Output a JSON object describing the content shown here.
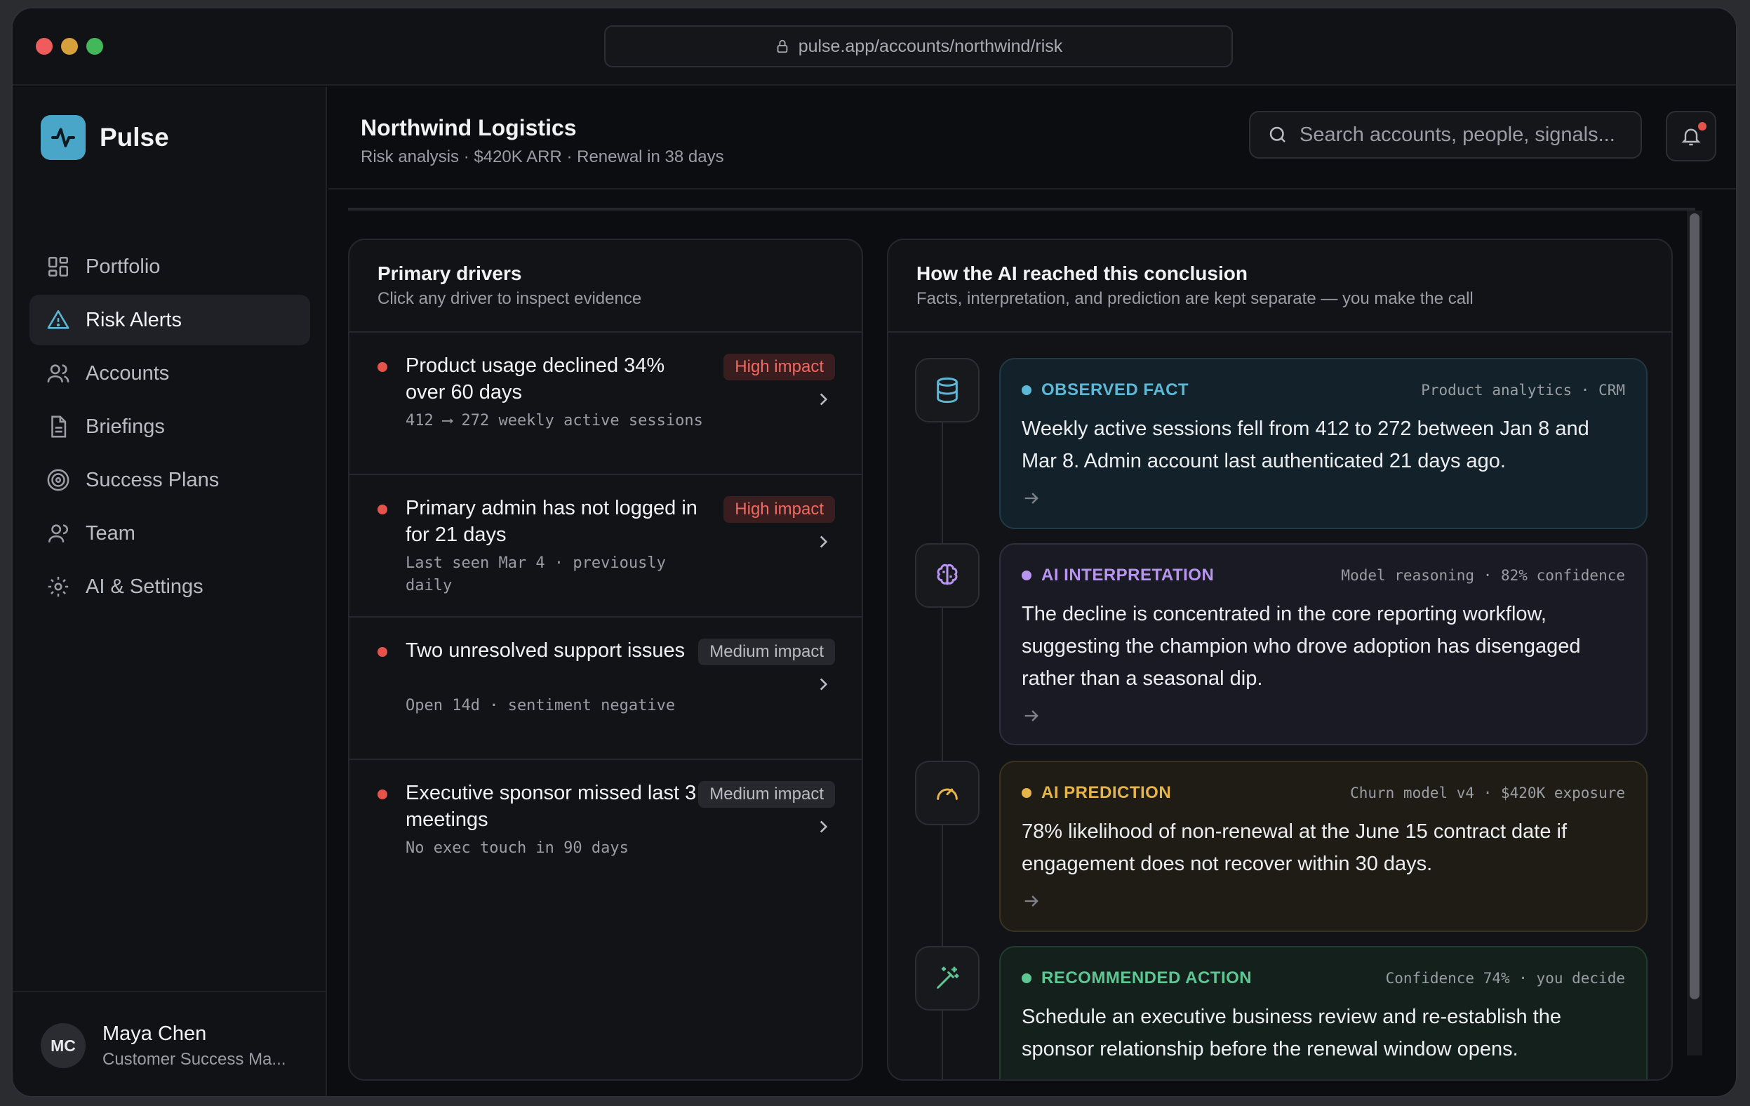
{
  "browser": {
    "url": "pulse.app/accounts/northwind/risk"
  },
  "brand": {
    "name": "Pulse"
  },
  "sidebar": {
    "items": [
      {
        "label": "Portfolio",
        "icon": "grid-icon"
      },
      {
        "label": "Risk Alerts",
        "icon": "alert-triangle-icon",
        "active": true
      },
      {
        "label": "Accounts",
        "icon": "users-icon"
      },
      {
        "label": "Briefings",
        "icon": "document-icon"
      },
      {
        "label": "Success Plans",
        "icon": "target-icon"
      },
      {
        "label": "Team",
        "icon": "user-icon"
      },
      {
        "label": "AI & Settings",
        "icon": "gear-icon"
      }
    ]
  },
  "user": {
    "initials": "MC",
    "name": "Maya Chen",
    "role": "Customer Success Ma..."
  },
  "header": {
    "title": "Northwind Logistics",
    "subtitle": "Risk analysis · $420K ARR · Renewal in 38 days",
    "search_placeholder": "Search accounts, people, signals..."
  },
  "drivers_panel": {
    "title": "Primary drivers",
    "subtitle": "Click any driver to inspect evidence",
    "drivers": [
      {
        "title": "Product usage declined 34% over 60 days",
        "meta": "412 ⟶ 272 weekly active sessions",
        "impact": "High impact",
        "level": "high"
      },
      {
        "title": "Primary admin has not logged in for 21 days",
        "meta": "Last seen Mar 4 · previously daily",
        "impact": "High impact",
        "level": "high"
      },
      {
        "title": "Two unresolved support issues",
        "meta": "Open 14d · sentiment negative",
        "impact": "Medium impact",
        "level": "medium"
      },
      {
        "title": "Executive sponsor missed last 3 meetings",
        "meta": "No exec touch in 90 days",
        "impact": "Medium impact",
        "level": "medium"
      }
    ]
  },
  "reasoning_panel": {
    "title": "How the AI reached this conclusion",
    "subtitle": "Facts, interpretation, and prediction are kept separate — you make the call",
    "steps": [
      {
        "tag": "OBSERVED FACT",
        "source": "Product analytics · CRM",
        "body": "Weekly active sessions fell from 412 to 272 between Jan 8 and Mar 8. Admin account last authenticated 21 days ago.",
        "color": "#5bb8d6",
        "icon": "database-icon"
      },
      {
        "tag": "AI INTERPRETATION",
        "source": "Model reasoning · 82% confidence",
        "body": "The decline is concentrated in the core reporting workflow, suggesting the champion who drove adoption has disengaged rather than a seasonal dip.",
        "color": "#b896f0",
        "icon": "brain-icon"
      },
      {
        "tag": "AI PREDICTION",
        "source": "Churn model v4 · $420K exposure",
        "body": "78% likelihood of non-renewal at the June 15 contract date if engagement does not recover within 30 days.",
        "color": "#e6b54a",
        "icon": "gauge-icon"
      },
      {
        "tag": "RECOMMENDED ACTION",
        "source": "Confidence 74% · you decide",
        "body": "Schedule an executive business review and re-establish the sponsor relationship before the renewal window opens.",
        "color": "#5cc792",
        "icon": "magic-wand-icon"
      }
    ]
  }
}
